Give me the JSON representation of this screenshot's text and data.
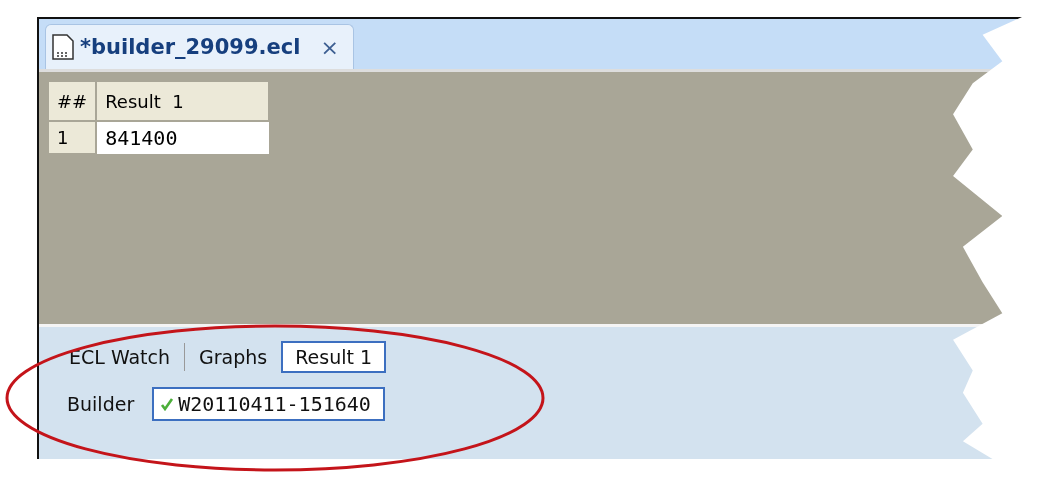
{
  "editor_tab": {
    "title": "*builder_29099.ecl",
    "close": "×"
  },
  "result_table": {
    "columns": [
      "##",
      "Result  1"
    ],
    "rows": [
      {
        "index": "1",
        "value": "841400"
      }
    ]
  },
  "result_tabs": [
    {
      "label": "ECL Watch",
      "selected": false
    },
    {
      "label": "Graphs",
      "selected": false
    },
    {
      "label": "Result 1",
      "selected": true
    }
  ],
  "workunit": {
    "label": "Builder",
    "completed": true,
    "value": "W20110411-151640"
  }
}
